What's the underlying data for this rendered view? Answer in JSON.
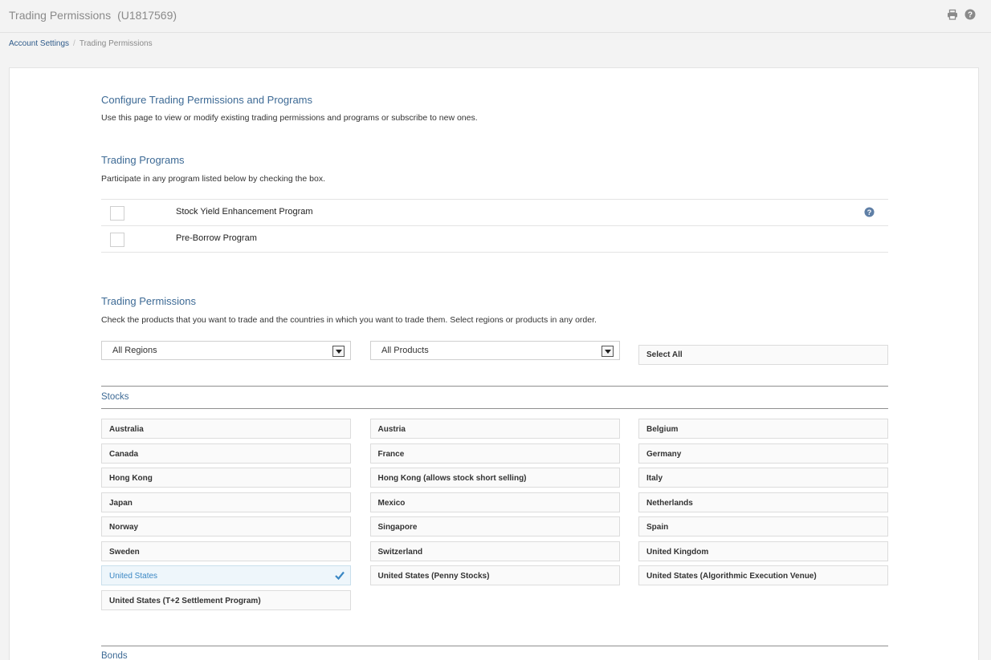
{
  "header": {
    "title": "Trading Permissions",
    "account": "(U1817569)",
    "print_icon": "print-icon",
    "help_icon": "help-icon"
  },
  "breadcrumb": {
    "parent": "Account Settings",
    "separator": "/",
    "current": "Trading Permissions"
  },
  "configure": {
    "heading": "Configure Trading Permissions and Programs",
    "description": "Use this page to view or modify existing trading permissions and programs or subscribe to new ones."
  },
  "programs": {
    "heading": "Trading Programs",
    "description": "Participate in any program listed below by checking the box.",
    "items": [
      {
        "label": "Stock Yield Enhancement Program",
        "checked": false,
        "has_help": true
      },
      {
        "label": "Pre-Borrow Program",
        "checked": false,
        "has_help": false
      }
    ]
  },
  "permissions": {
    "heading": "Trading Permissions",
    "description": "Check the products that you want to trade and the countries in which you want to trade them. Select regions or products in any order.",
    "region_select": "All Regions",
    "product_select": "All Products",
    "select_all": "Select All"
  },
  "stocks": {
    "title": "Stocks",
    "items": [
      {
        "label": "Australia",
        "checked": false
      },
      {
        "label": "Austria",
        "checked": false
      },
      {
        "label": "Belgium",
        "checked": false
      },
      {
        "label": "Canada",
        "checked": false
      },
      {
        "label": "France",
        "checked": false
      },
      {
        "label": "Germany",
        "checked": false
      },
      {
        "label": "Hong Kong",
        "checked": false
      },
      {
        "label": "Hong Kong (allows stock short selling)",
        "checked": false
      },
      {
        "label": "Italy",
        "checked": false
      },
      {
        "label": "Japan",
        "checked": false
      },
      {
        "label": "Mexico",
        "checked": false
      },
      {
        "label": "Netherlands",
        "checked": false
      },
      {
        "label": "Norway",
        "checked": false
      },
      {
        "label": "Singapore",
        "checked": false
      },
      {
        "label": "Spain",
        "checked": false
      },
      {
        "label": "Sweden",
        "checked": false
      },
      {
        "label": "Switzerland",
        "checked": false
      },
      {
        "label": "United Kingdom",
        "checked": false
      },
      {
        "label": "United States",
        "checked": true
      },
      {
        "label": "United States (Penny Stocks)",
        "checked": false
      },
      {
        "label": "United States (Algorithmic Execution Venue)",
        "checked": false
      },
      {
        "label": "United States (T+2 Settlement Program)",
        "checked": false
      }
    ]
  },
  "bonds": {
    "title": "Bonds"
  },
  "colors": {
    "accent": "#3d6a95",
    "checked_text": "#3a87c4"
  }
}
